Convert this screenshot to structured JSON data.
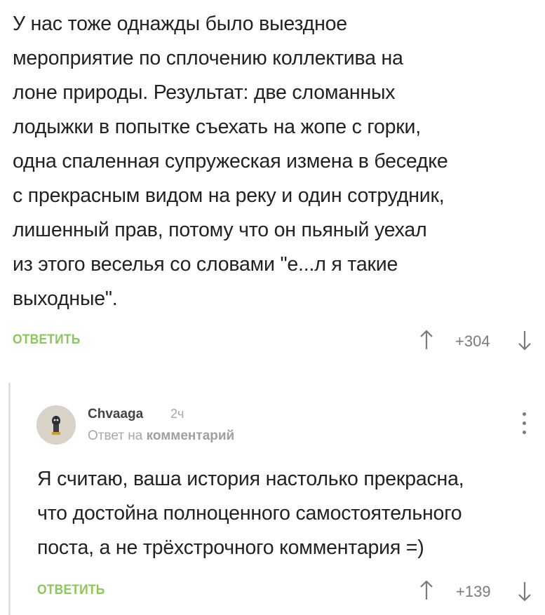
{
  "comment1": {
    "text": "У нас тоже однажды было выездное\nмероприятие по сплочению коллектива на\nлоне природы. Результат: две сломанных\nлодыжки в попытке съехать на жопе с горки,\nодна спаленная супружеская измена в беседке\nс прекрасным видом на реку и один сотрудник,\nлишенный прав, потому что он пьяный уехал\nиз этого веселья со словами \"е...л я такие\nвыходные\".",
    "reply_label": "ОТВЕТИТЬ",
    "score": "+304",
    "up_icon": "arrow-up-icon",
    "down_icon": "arrow-down-icon"
  },
  "comment2": {
    "username": "Chvaaga",
    "time": "2ч",
    "reply_to_prefix": "Ответ на",
    "reply_to_link": "комментарий",
    "text": "Я считаю, ваша история настолько прекрасна,\nчто достойна полноценного самостоятельного\nпоста, а не трёхстрочного комментария =)",
    "reply_label": "ОТВЕТИТЬ",
    "score": "+139",
    "avatar_icon": "avatar-image",
    "menu_icon": "more-vertical-icon"
  },
  "colors": {
    "accent_green": "#8ac858",
    "text": "#222222",
    "muted": "#a8a8a8",
    "score": "#7a7a7a",
    "thread_line": "#e0e0e0"
  }
}
